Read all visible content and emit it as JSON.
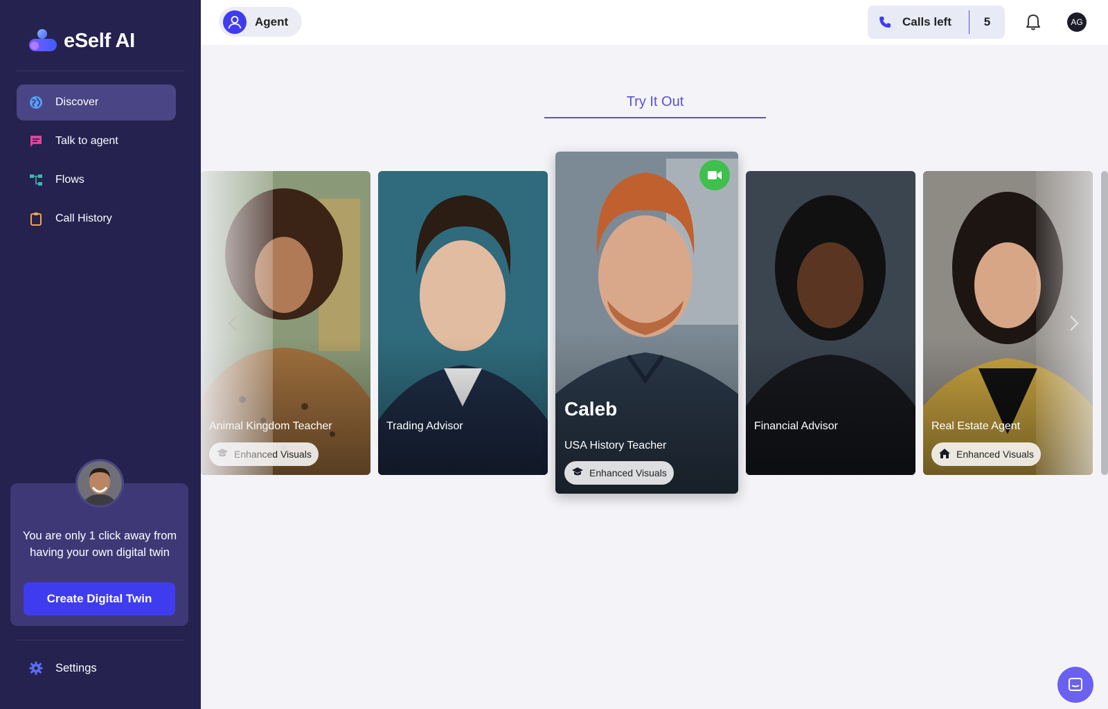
{
  "brand": {
    "name": "eSelf AI"
  },
  "sidebar": {
    "items": [
      {
        "label": "Discover",
        "icon": "globe-icon",
        "active": true
      },
      {
        "label": "Talk to agent",
        "icon": "chat-icon",
        "active": false
      },
      {
        "label": "Flows",
        "icon": "flows-icon",
        "active": false
      },
      {
        "label": "Call History",
        "icon": "clipboard-icon",
        "active": false
      }
    ],
    "promo": {
      "text": "You are only 1 click away from having your own digital twin",
      "button_label": "Create Digital Twin"
    },
    "settings_label": "Settings"
  },
  "topbar": {
    "agent_label": "Agent",
    "calls_label": "Calls left",
    "calls_count": "5",
    "user_initials": "AG"
  },
  "main": {
    "tab_label": "Try It Out",
    "cards": [
      {
        "title": "Animal Kingdom Teacher",
        "badge": "Enhanced Visuals",
        "badge_icon": "graduation-cap-icon",
        "featured": false
      },
      {
        "title": "Trading Advisor",
        "badge": "",
        "featured": false
      },
      {
        "name": "Caleb",
        "title": "USA History Teacher",
        "badge": "Enhanced Visuals",
        "badge_icon": "graduation-cap-icon",
        "featured": true
      },
      {
        "title": "Financial Advisor",
        "badge": "",
        "featured": false
      },
      {
        "title": "Real Estate Agent",
        "badge": "Enhanced Visuals",
        "badge_icon": "home-icon",
        "featured": false
      }
    ]
  },
  "colors": {
    "sidebar_bg": "#25224f",
    "accent": "#3f3cf0",
    "tab_accent": "#5a4fd6",
    "video_green": "#3fbf4d"
  }
}
